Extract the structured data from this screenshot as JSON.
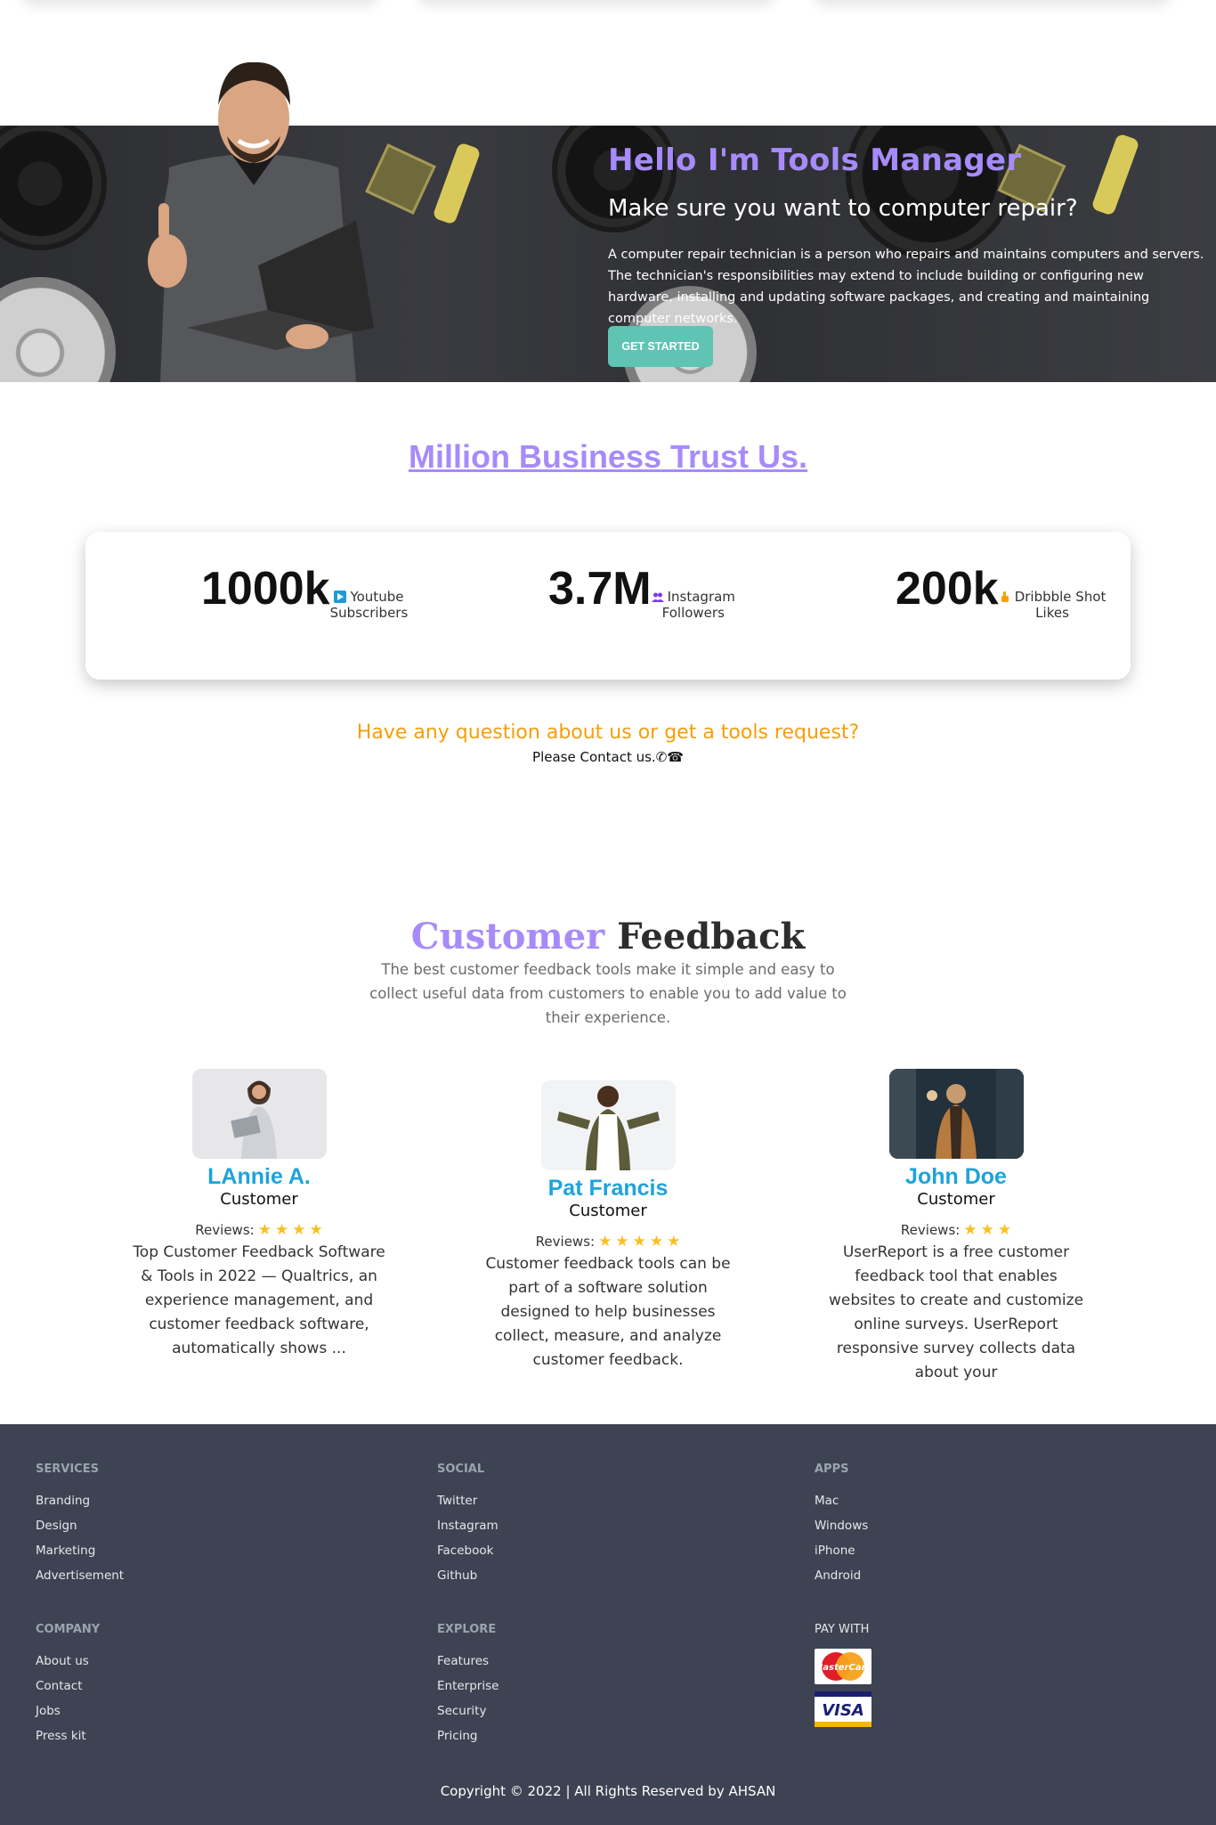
{
  "hero": {
    "title": "Hello I'm Tools Manager",
    "subtitle": "Make sure you want to computer repair?",
    "description": "A computer repair technician is a person who repairs and maintains computers and servers. The technician's responsibilities may extend to include building or configuring new hardware, installing and updating software packages, and creating and maintaining computer networks.",
    "cta_label": "GET STARTED"
  },
  "trust": {
    "title": "Million Business Trust Us.",
    "stats": [
      {
        "value": "1000k",
        "label_line1": "Youtube",
        "label_line2": "Subscribers",
        "icon": "youtube-icon"
      },
      {
        "value": "3.7M",
        "label_line1": "Instagram",
        "label_line2": "Followers",
        "icon": "people-icon"
      },
      {
        "value": "200k",
        "label_line1": "Dribbble Shot",
        "label_line2": "Likes",
        "icon": "thumbs-up-icon"
      }
    ]
  },
  "contact": {
    "question": "Have any question about us or get a tools request?",
    "prompt": "Please Contact us.",
    "icons": "✆☎"
  },
  "feedback": {
    "title_part1": "Customer",
    "title_part2": "Feedback",
    "description": "The best customer feedback tools make it simple and easy to collect useful data from customers to enable you to add value to their experience.",
    "reviews_label": "Reviews:",
    "customers": [
      {
        "name": "LAnnie A.",
        "role": "Customer",
        "stars": 4,
        "text": "Top Customer Feedback Software & Tools in 2022 — Qualtrics, an experience management, and customer feedback software, automatically shows ..."
      },
      {
        "name": "Pat Francis",
        "role": "Customer",
        "stars": 5,
        "text": "Customer feedback tools can be part of a software solution designed to help businesses collect, measure, and analyze customer feedback."
      },
      {
        "name": "John Doe",
        "role": "Customer",
        "stars": 3,
        "text": "UserReport is a free customer feedback tool that enables websites to create and customize online surveys. UserReport responsive survey collects data about your"
      }
    ]
  },
  "footer": {
    "services": {
      "heading": "SERVICES",
      "links": [
        "Branding",
        "Design",
        "Marketing",
        "Advertisement"
      ]
    },
    "social": {
      "heading": "SOCIAL",
      "links": [
        "Twitter",
        "Instagram",
        "Facebook",
        "Github"
      ]
    },
    "apps": {
      "heading": "APPS",
      "links": [
        "Mac",
        "Windows",
        "iPhone",
        "Android"
      ]
    },
    "company": {
      "heading": "COMPANY",
      "links": [
        "About us",
        "Contact",
        "Jobs",
        "Press kit"
      ]
    },
    "explore": {
      "heading": "EXPLORE",
      "links": [
        "Features",
        "Enterprise",
        "Security",
        "Pricing"
      ]
    },
    "pay": {
      "heading": "PAY WITH",
      "logos": [
        "MasterCard",
        "VISA"
      ]
    },
    "copyright": "Copyright © 2022 | All Rights Reserved by AHSAN"
  },
  "colors": {
    "accent_purple": "#a78bfa",
    "accent_teal": "#5fc4b4",
    "accent_orange": "#f59e0b",
    "name_blue": "#1ea3dc",
    "footer_bg": "#3d4352"
  }
}
